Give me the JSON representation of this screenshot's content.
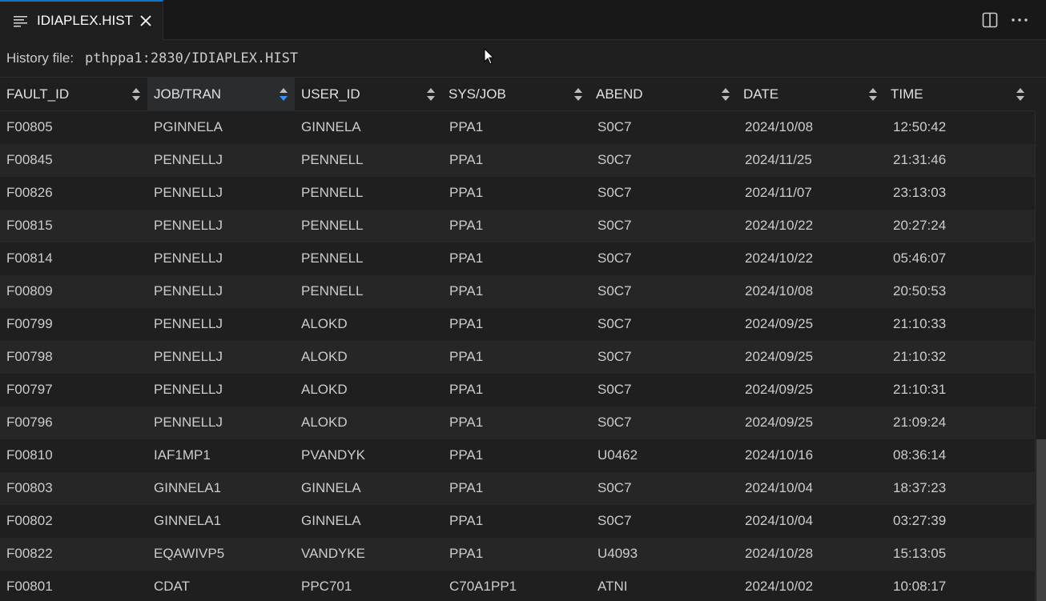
{
  "tab": {
    "icon": "list-lines-icon",
    "title": "IDIAPLEX.HIST",
    "close_icon": "close-icon",
    "accent": "#0078d4"
  },
  "toolbar": {
    "split_icon": "split-editor-icon",
    "more_icon": "more-actions-icon"
  },
  "history": {
    "label": "History file:",
    "path": "pthppa1:2830/IDIAPLEX.HIST"
  },
  "columns": [
    {
      "label": "FAULT_ID",
      "sorted": false
    },
    {
      "label": "JOB/TRAN",
      "sorted": true
    },
    {
      "label": "USER_ID",
      "sorted": false
    },
    {
      "label": "SYS/JOB",
      "sorted": false
    },
    {
      "label": "ABEND",
      "sorted": false
    },
    {
      "label": "DATE",
      "sorted": false
    },
    {
      "label": "TIME",
      "sorted": false
    }
  ],
  "rows": [
    [
      "F00805",
      "PGINNELA",
      "GINNELA",
      "PPA1",
      "S0C7",
      "2024/10/08",
      "12:50:42"
    ],
    [
      "F00845",
      "PENNELLJ",
      "PENNELL",
      "PPA1",
      "S0C7",
      "2024/11/25",
      "21:31:46"
    ],
    [
      "F00826",
      "PENNELLJ",
      "PENNELL",
      "PPA1",
      "S0C7",
      "2024/11/07",
      "23:13:03"
    ],
    [
      "F00815",
      "PENNELLJ",
      "PENNELL",
      "PPA1",
      "S0C7",
      "2024/10/22",
      "20:27:24"
    ],
    [
      "F00814",
      "PENNELLJ",
      "PENNELL",
      "PPA1",
      "S0C7",
      "2024/10/22",
      "05:46:07"
    ],
    [
      "F00809",
      "PENNELLJ",
      "PENNELL",
      "PPA1",
      "S0C7",
      "2024/10/08",
      "20:50:53"
    ],
    [
      "F00799",
      "PENNELLJ",
      "ALOKD",
      "PPA1",
      "S0C7",
      "2024/09/25",
      "21:10:33"
    ],
    [
      "F00798",
      "PENNELLJ",
      "ALOKD",
      "PPA1",
      "S0C7",
      "2024/09/25",
      "21:10:32"
    ],
    [
      "F00797",
      "PENNELLJ",
      "ALOKD",
      "PPA1",
      "S0C7",
      "2024/09/25",
      "21:10:31"
    ],
    [
      "F00796",
      "PENNELLJ",
      "ALOKD",
      "PPA1",
      "S0C7",
      "2024/09/25",
      "21:09:24"
    ],
    [
      "F00810",
      "IAF1MP1",
      "PVANDYK",
      "PPA1",
      "U0462",
      "2024/10/16",
      "08:36:14"
    ],
    [
      "F00803",
      "GINNELA1",
      "GINNELA",
      "PPA1",
      "S0C7",
      "2024/10/04",
      "18:37:23"
    ],
    [
      "F00802",
      "GINNELA1",
      "GINNELA",
      "PPA1",
      "S0C7",
      "2024/10/04",
      "03:27:39"
    ],
    [
      "F00822",
      "EQAWIVP5",
      "VANDYKE",
      "PPA1",
      "U4093",
      "2024/10/28",
      "15:13:05"
    ],
    [
      "F00801",
      "CDAT",
      "PPC701",
      "C70A1PP1",
      "ATNI",
      "2024/10/02",
      "10:08:17"
    ]
  ]
}
